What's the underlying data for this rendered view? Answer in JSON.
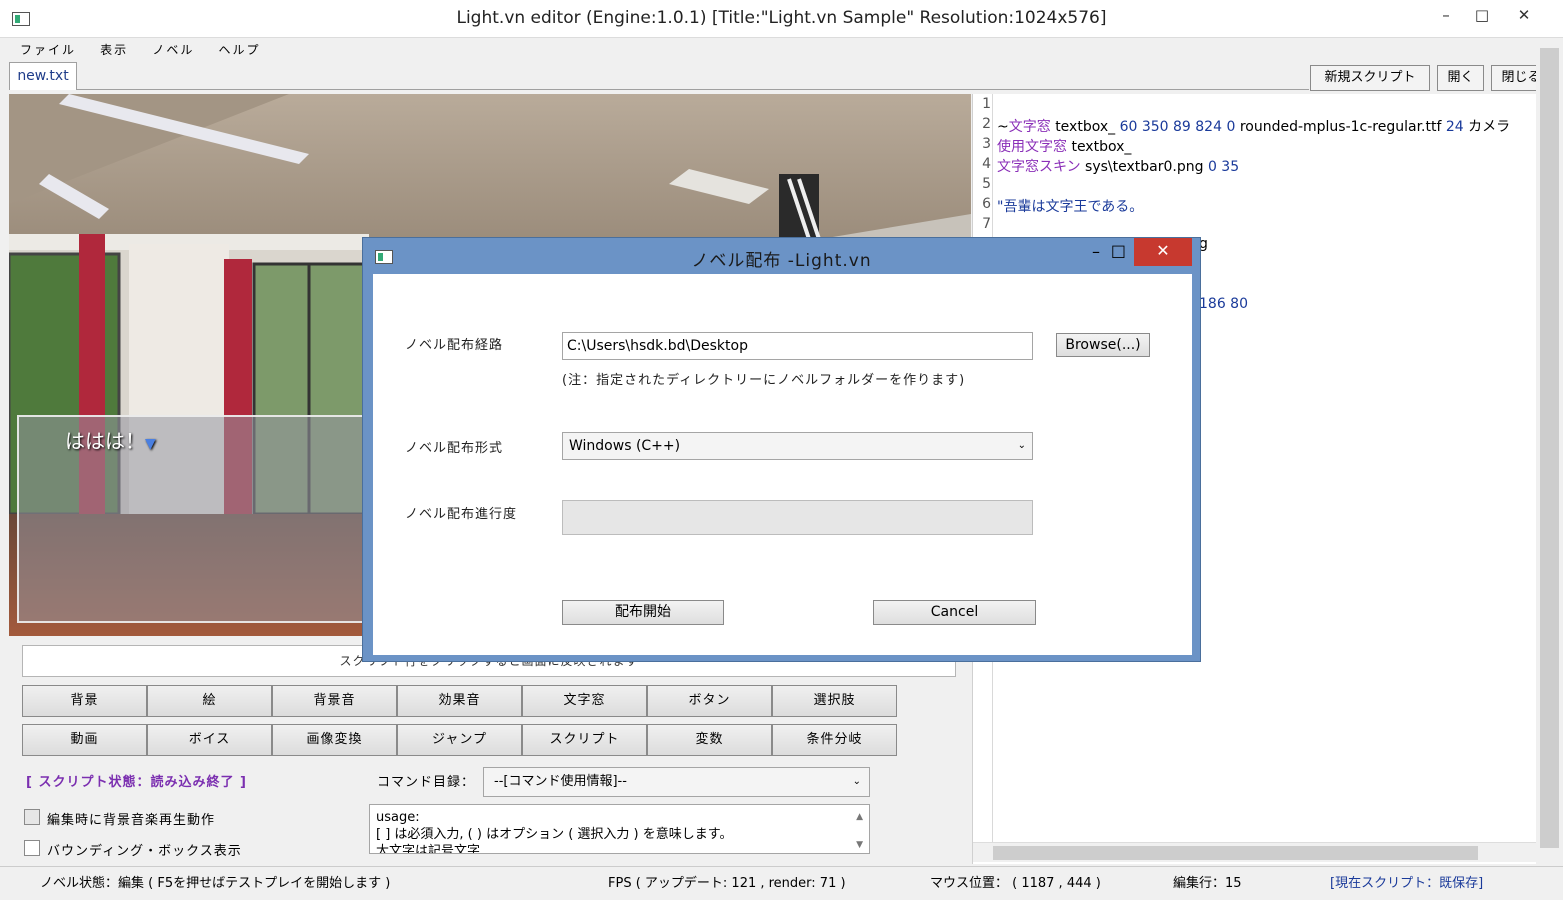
{
  "window": {
    "title": "Light.vn editor (Engine:1.0.1) [Title:\"Light.vn Sample\" Resolution:1024x576]",
    "minimize": "–",
    "maximize": "□",
    "close": "✕"
  },
  "menu": [
    "ファイル",
    "表示",
    "ノベル",
    "ヘルプ"
  ],
  "tab": {
    "active": "new.txt"
  },
  "toolbar": {
    "new_script": "新規スクリプト",
    "open": "開く",
    "close": "閉じる"
  },
  "scene": {
    "message": "ははは！",
    "cursor": "▼"
  },
  "hint": "スクリプト行をクリックすると画面に反映されます",
  "buttons_row1": [
    "背景",
    "絵",
    "背景音",
    "効果音",
    "文字窓",
    "ボタン",
    "選択肢"
  ],
  "buttons_row2": [
    "動画",
    "ボイス",
    "画像変換",
    "ジャンプ",
    "スクリプト",
    "変数",
    "条件分岐"
  ],
  "script_status": "[ スクリプト状態：読み込み終了 ]",
  "command": {
    "label": "コマンド目録：",
    "selected": "--[コマンド使用情報]--"
  },
  "checkboxes": [
    "編集時に背景音楽再生動作",
    "バウンディング・ボックス表示"
  ],
  "usage": {
    "line1": "usage:",
    "line2": "[  ] は必須入力, (  ) はオプション ( 選択入力 ) を意味します。",
    "line3": "大文字は記号文字"
  },
  "editor": {
    "line_numbers": [
      "1",
      "2",
      "3",
      "4",
      "5",
      "6",
      "7"
    ],
    "line2": {
      "prefix": "~",
      "kw": "文字窓",
      "name": "textbox_",
      "nums": "60 350 89 824 0",
      "font": "rounded-mplus-1c-regular.ttf",
      "size": "24",
      "tail": "カメラ"
    },
    "line3": {
      "kw": "使用文字窓",
      "name": "textbox_"
    },
    "line4": {
      "kw": "文字窓スキン",
      "path": "sys\\textbar0.png",
      "nums": "0 35"
    },
    "line6": {
      "text": "\"吾輩は文字王である。"
    },
    "frag_g": "g",
    "frag_nums": "186 80"
  },
  "dialog": {
    "title": "ノベル配布 -Light.vn",
    "path_label": "ノベル配布経路",
    "path_value": "C:\\Users\\hsdk.bd\\Desktop",
    "browse": "Browse(...)",
    "note": "(注：指定されたディレクトリーにノベルフォルダーを作ります)",
    "format_label": "ノベル配布形式",
    "format_value": "Windows (C++)",
    "progress_label": "ノベル配布進行度",
    "progress": 0,
    "start": "配布開始",
    "cancel": "Cancel"
  },
  "statusbar": {
    "novel_state": "ノベル状態：編集 ( F5を押せばテストプレイを開始します )",
    "fps": "FPS ( アップデート: 121 , render: 71 )",
    "mouse": "マウス位置： ( 1187 , 444 )",
    "edit_line": "編集行：15",
    "current_script": "[現在スクリプト：既保存]"
  },
  "colors": {
    "accent": "#7b2fb0",
    "dialog_frame": "#6b93c6",
    "close_red": "#c7392f"
  }
}
